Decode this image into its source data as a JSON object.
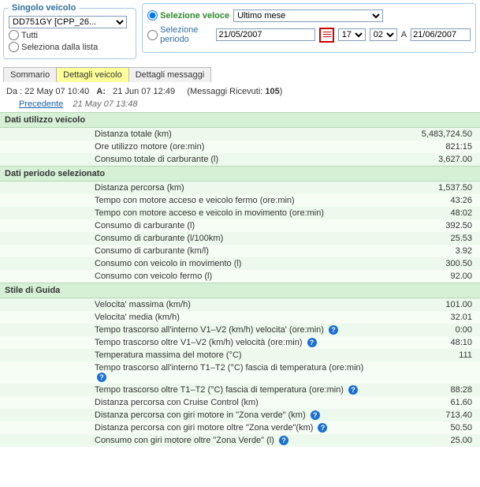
{
  "filters": {
    "left": {
      "legend": "Singolo veicolo",
      "vehicle_options": [
        "DD751GY [CPP_26..."
      ],
      "vehicle_selected": "DD751GY [CPP_26...",
      "opt_all": "Tutti",
      "opt_list": "Seleziona dalla lista"
    },
    "right": {
      "quick_label": "Selezione veloce",
      "quick_options": [
        "Ultimo mese"
      ],
      "quick_selected": "Ultimo mese",
      "period_label": "Selezione periodo",
      "date_from": "21/05/2007",
      "hh_options": [
        "17"
      ],
      "hh_selected": "17",
      "mm_options": [
        "02"
      ],
      "mm_selected": "02",
      "sep": "A",
      "date_to": "21/06/2007"
    }
  },
  "tabs": {
    "summary": "Sommario",
    "vehicle": "Dettagli veicolo",
    "messages": "Dettagli messaggi"
  },
  "info": {
    "from_lbl": "Da :",
    "from_val": "22 May 07 10:40",
    "to_lbl": "A:",
    "to_val": "21 Jun 07 12:49",
    "msgs_lbl": "(Messaggi Ricevuti: ",
    "msgs_val": "105",
    "msgs_close": ")",
    "prev_link": "Precedente",
    "prev_val": "21 May 07 13:48"
  },
  "sections": [
    {
      "title": "Dati utilizzo veicolo",
      "rows": [
        {
          "label": "Distanza totale (km)",
          "value": "5,483,724.50"
        },
        {
          "label": "Ore utilizzo motore (ore:min)",
          "value": "821:15"
        },
        {
          "label": "Consumo totale di carburante (l)",
          "value": "3,627.00"
        }
      ]
    },
    {
      "title": "Dati periodo selezionato",
      "rows": [
        {
          "label": "Distanza percorsa (km)",
          "value": "1,537.50"
        },
        {
          "label": "Tempo con motore acceso e veicolo fermo (ore:min)",
          "value": "43:26"
        },
        {
          "label": "Tempo con motore acceso e veicolo in movimento (ore:min)",
          "value": "48:02"
        },
        {
          "label": "Consumo di carburante (l)",
          "value": "392.50"
        },
        {
          "label": "Consumo di carburante (l/100km)",
          "value": "25.53"
        },
        {
          "label": "Consumo di carburante (km/l)",
          "value": "3.92"
        },
        {
          "label": "Consumo con veicolo in movimento (l)",
          "value": "300.50"
        },
        {
          "label": "Consumo con veicolo fermo (l)",
          "value": "92.00"
        }
      ]
    },
    {
      "title": "Stile di Guida",
      "rows": [
        {
          "label": "Velocita' massima (km/h)",
          "value": "101.00"
        },
        {
          "label": "Velocita' media (km/h)",
          "value": "32.01"
        },
        {
          "label": "Tempo trascorso all'interno V1–V2 (km/h) velocita' (ore:min)",
          "value": "0:00",
          "help": true
        },
        {
          "label": "Tempo trascorso oltre V1–V2 (km/h) velocità (ore:min)",
          "value": "48:10",
          "help": true
        },
        {
          "label": "Temperatura massima del motore (°C)",
          "value": "111"
        },
        {
          "label": "Tempo trascorso all'interno T1–T2 (°C) fascia di temperatura (ore:min)",
          "value": "",
          "help": true
        },
        {
          "label": "Tempo trascorso oltre T1–T2 (°C) fascia di temperatura (ore:min)",
          "value": "88:28",
          "help": true
        },
        {
          "label": "Distanza percorsa con Cruise Control (km)",
          "value": "61.60"
        },
        {
          "label": "Distanza percorsa con giri motore in \"Zona verde\" (km)",
          "value": "713.40",
          "help": true
        },
        {
          "label": "Distanza percorsa con giri motore oltre \"Zona verde\"(km)",
          "value": "50.50",
          "help": true
        },
        {
          "label": "Consumo con giri motore oltre \"Zona Verde\" (l)",
          "value": "25.00",
          "help": true
        }
      ]
    }
  ]
}
